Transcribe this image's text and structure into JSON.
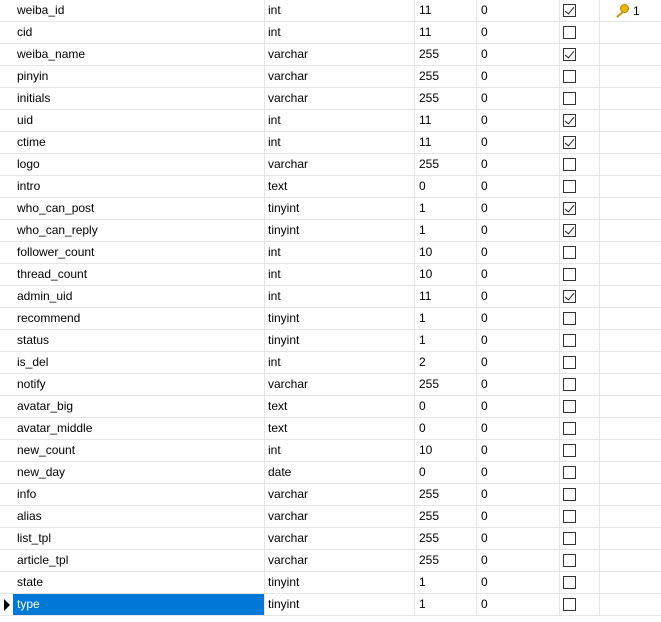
{
  "columns": [
    {
      "name": "weiba_id",
      "type": "int",
      "length": "11",
      "decimals": "0",
      "not_null": true,
      "key": "1"
    },
    {
      "name": "cid",
      "type": "int",
      "length": "11",
      "decimals": "0",
      "not_null": false
    },
    {
      "name": "weiba_name",
      "type": "varchar",
      "length": "255",
      "decimals": "0",
      "not_null": true
    },
    {
      "name": "pinyin",
      "type": "varchar",
      "length": "255",
      "decimals": "0",
      "not_null": false
    },
    {
      "name": "initials",
      "type": "varchar",
      "length": "255",
      "decimals": "0",
      "not_null": false
    },
    {
      "name": "uid",
      "type": "int",
      "length": "11",
      "decimals": "0",
      "not_null": true
    },
    {
      "name": "ctime",
      "type": "int",
      "length": "11",
      "decimals": "0",
      "not_null": true
    },
    {
      "name": "logo",
      "type": "varchar",
      "length": "255",
      "decimals": "0",
      "not_null": false
    },
    {
      "name": "intro",
      "type": "text",
      "length": "0",
      "decimals": "0",
      "not_null": false
    },
    {
      "name": "who_can_post",
      "type": "tinyint",
      "length": "1",
      "decimals": "0",
      "not_null": true
    },
    {
      "name": "who_can_reply",
      "type": "tinyint",
      "length": "1",
      "decimals": "0",
      "not_null": true
    },
    {
      "name": "follower_count",
      "type": "int",
      "length": "10",
      "decimals": "0",
      "not_null": false
    },
    {
      "name": "thread_count",
      "type": "int",
      "length": "10",
      "decimals": "0",
      "not_null": false
    },
    {
      "name": "admin_uid",
      "type": "int",
      "length": "11",
      "decimals": "0",
      "not_null": true
    },
    {
      "name": "recommend",
      "type": "tinyint",
      "length": "1",
      "decimals": "0",
      "not_null": false
    },
    {
      "name": "status",
      "type": "tinyint",
      "length": "1",
      "decimals": "0",
      "not_null": false
    },
    {
      "name": "is_del",
      "type": "int",
      "length": "2",
      "decimals": "0",
      "not_null": false
    },
    {
      "name": "notify",
      "type": "varchar",
      "length": "255",
      "decimals": "0",
      "not_null": false
    },
    {
      "name": "avatar_big",
      "type": "text",
      "length": "0",
      "decimals": "0",
      "not_null": false
    },
    {
      "name": "avatar_middle",
      "type": "text",
      "length": "0",
      "decimals": "0",
      "not_null": false
    },
    {
      "name": "new_count",
      "type": "int",
      "length": "10",
      "decimals": "0",
      "not_null": false
    },
    {
      "name": "new_day",
      "type": "date",
      "length": "0",
      "decimals": "0",
      "not_null": false
    },
    {
      "name": "info",
      "type": "varchar",
      "length": "255",
      "decimals": "0",
      "not_null": false
    },
    {
      "name": "alias",
      "type": "varchar",
      "length": "255",
      "decimals": "0",
      "not_null": false
    },
    {
      "name": "list_tpl",
      "type": "varchar",
      "length": "255",
      "decimals": "0",
      "not_null": false
    },
    {
      "name": "article_tpl",
      "type": "varchar",
      "length": "255",
      "decimals": "0",
      "not_null": false
    },
    {
      "name": "state",
      "type": "tinyint",
      "length": "1",
      "decimals": "0",
      "not_null": false
    },
    {
      "name": "type",
      "type": "tinyint",
      "length": "1",
      "decimals": "0",
      "not_null": false,
      "selected": true
    }
  ],
  "icons": {
    "primary_key": "key-icon",
    "current_row": "row-pointer-icon"
  },
  "colors": {
    "selection": "#0078d7",
    "grid_line": "#e6e6e6",
    "key_gold": "#e8b500"
  }
}
